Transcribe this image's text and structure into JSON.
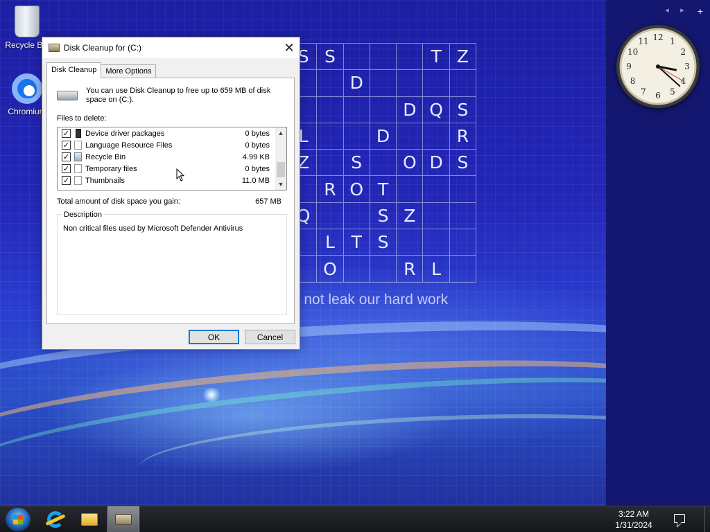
{
  "desktop": {
    "icons": [
      {
        "label": "Recycle Bin",
        "icon": "recycle-bin-icon"
      },
      {
        "label": "Chromium",
        "icon": "chromium-icon"
      }
    ],
    "wallpaper": {
      "letter_grid": [
        [
          "S",
          "S",
          "",
          "",
          "",
          "T",
          "Z"
        ],
        [
          "",
          "",
          "D",
          "",
          "",
          "",
          ""
        ],
        [
          "",
          "",
          "",
          "",
          "D",
          "Q",
          "S"
        ],
        [
          "L",
          "",
          "",
          "D",
          "",
          "",
          "R"
        ],
        [
          "Z",
          "",
          "S",
          "",
          "O",
          "D",
          "S"
        ],
        [
          "",
          "R",
          "O",
          "T",
          "",
          "",
          ""
        ],
        [
          "Q",
          "",
          "",
          "S",
          "Z",
          "",
          ""
        ],
        [
          "",
          "L",
          "T",
          "S",
          "",
          "",
          ""
        ],
        [
          "",
          "O",
          "",
          "",
          "R",
          "L",
          ""
        ]
      ],
      "tagline": "'s not leak our hard work"
    }
  },
  "gadgets": {
    "controls": [
      "◂",
      "▸",
      "+"
    ],
    "clock": {
      "hour": 3,
      "minute": 22,
      "second": 20
    }
  },
  "dialog": {
    "title": "Disk Cleanup for  (C:)",
    "close_glyph": "✕",
    "tabs": [
      {
        "label": "Disk Cleanup",
        "active": true
      },
      {
        "label": "More Options",
        "active": false
      }
    ],
    "intro": "You can use Disk Cleanup to free up to 659 MB of disk space on  (C:).",
    "files_label": "Files to delete:",
    "files": [
      {
        "name": "Device driver packages",
        "size": "0 bytes",
        "checked": true,
        "icon": "device-driver-icon"
      },
      {
        "name": "Language Resource Files",
        "size": "0 bytes",
        "checked": true,
        "icon": "file-icon"
      },
      {
        "name": "Recycle Bin",
        "size": "4.99 KB",
        "checked": true,
        "icon": "recycle-bin-icon"
      },
      {
        "name": "Temporary files",
        "size": "0 bytes",
        "checked": true,
        "icon": "file-icon"
      },
      {
        "name": "Thumbnails",
        "size": "11.0 MB",
        "checked": true,
        "icon": "file-icon"
      }
    ],
    "total_label": "Total amount of disk space you gain:",
    "total_value": "657 MB",
    "description_label": "Description",
    "description_text": "Non critical files used by Microsoft Defender Antivirus",
    "ok_label": "OK",
    "cancel_label": "Cancel"
  },
  "taskbar": {
    "time": "3:22 AM",
    "date": "1/31/2024",
    "pinned": [
      {
        "name": "internet-explorer",
        "icon": "internet-explorer-icon"
      },
      {
        "name": "file-explorer",
        "icon": "folder-icon"
      },
      {
        "name": "disk-cleanup",
        "icon": "disk-cleanup-icon",
        "active": true
      }
    ]
  }
}
